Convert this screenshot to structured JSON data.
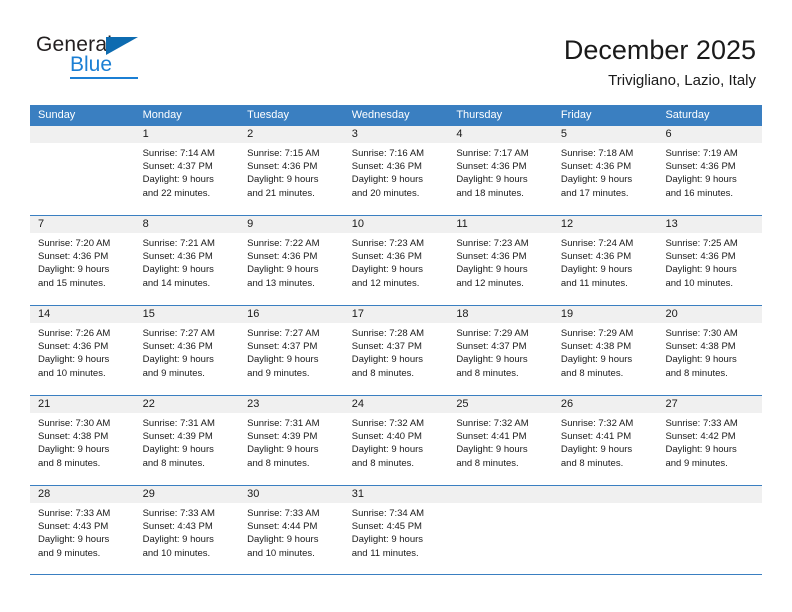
{
  "branding": {
    "name_part1": "General",
    "name_part2": "Blue",
    "logo_icon": "blue-triangle-icon"
  },
  "header": {
    "title": "December 2025",
    "subtitle": "Trivigliano, Lazio, Italy"
  },
  "calendar": {
    "weekdays": [
      "Sunday",
      "Monday",
      "Tuesday",
      "Wednesday",
      "Thursday",
      "Friday",
      "Saturday"
    ],
    "accent_color": "#3a7fc1",
    "daynum_background": "#f0f0f0",
    "weeks": [
      [
        {
          "day": "",
          "sunrise": "",
          "sunset": "",
          "daylight_line1": "",
          "daylight_line2": ""
        },
        {
          "day": "1",
          "sunrise": "Sunrise: 7:14 AM",
          "sunset": "Sunset: 4:37 PM",
          "daylight_line1": "Daylight: 9 hours",
          "daylight_line2": "and 22 minutes."
        },
        {
          "day": "2",
          "sunrise": "Sunrise: 7:15 AM",
          "sunset": "Sunset: 4:36 PM",
          "daylight_line1": "Daylight: 9 hours",
          "daylight_line2": "and 21 minutes."
        },
        {
          "day": "3",
          "sunrise": "Sunrise: 7:16 AM",
          "sunset": "Sunset: 4:36 PM",
          "daylight_line1": "Daylight: 9 hours",
          "daylight_line2": "and 20 minutes."
        },
        {
          "day": "4",
          "sunrise": "Sunrise: 7:17 AM",
          "sunset": "Sunset: 4:36 PM",
          "daylight_line1": "Daylight: 9 hours",
          "daylight_line2": "and 18 minutes."
        },
        {
          "day": "5",
          "sunrise": "Sunrise: 7:18 AM",
          "sunset": "Sunset: 4:36 PM",
          "daylight_line1": "Daylight: 9 hours",
          "daylight_line2": "and 17 minutes."
        },
        {
          "day": "6",
          "sunrise": "Sunrise: 7:19 AM",
          "sunset": "Sunset: 4:36 PM",
          "daylight_line1": "Daylight: 9 hours",
          "daylight_line2": "and 16 minutes."
        }
      ],
      [
        {
          "day": "7",
          "sunrise": "Sunrise: 7:20 AM",
          "sunset": "Sunset: 4:36 PM",
          "daylight_line1": "Daylight: 9 hours",
          "daylight_line2": "and 15 minutes."
        },
        {
          "day": "8",
          "sunrise": "Sunrise: 7:21 AM",
          "sunset": "Sunset: 4:36 PM",
          "daylight_line1": "Daylight: 9 hours",
          "daylight_line2": "and 14 minutes."
        },
        {
          "day": "9",
          "sunrise": "Sunrise: 7:22 AM",
          "sunset": "Sunset: 4:36 PM",
          "daylight_line1": "Daylight: 9 hours",
          "daylight_line2": "and 13 minutes."
        },
        {
          "day": "10",
          "sunrise": "Sunrise: 7:23 AM",
          "sunset": "Sunset: 4:36 PM",
          "daylight_line1": "Daylight: 9 hours",
          "daylight_line2": "and 12 minutes."
        },
        {
          "day": "11",
          "sunrise": "Sunrise: 7:23 AM",
          "sunset": "Sunset: 4:36 PM",
          "daylight_line1": "Daylight: 9 hours",
          "daylight_line2": "and 12 minutes."
        },
        {
          "day": "12",
          "sunrise": "Sunrise: 7:24 AM",
          "sunset": "Sunset: 4:36 PM",
          "daylight_line1": "Daylight: 9 hours",
          "daylight_line2": "and 11 minutes."
        },
        {
          "day": "13",
          "sunrise": "Sunrise: 7:25 AM",
          "sunset": "Sunset: 4:36 PM",
          "daylight_line1": "Daylight: 9 hours",
          "daylight_line2": "and 10 minutes."
        }
      ],
      [
        {
          "day": "14",
          "sunrise": "Sunrise: 7:26 AM",
          "sunset": "Sunset: 4:36 PM",
          "daylight_line1": "Daylight: 9 hours",
          "daylight_line2": "and 10 minutes."
        },
        {
          "day": "15",
          "sunrise": "Sunrise: 7:27 AM",
          "sunset": "Sunset: 4:36 PM",
          "daylight_line1": "Daylight: 9 hours",
          "daylight_line2": "and 9 minutes."
        },
        {
          "day": "16",
          "sunrise": "Sunrise: 7:27 AM",
          "sunset": "Sunset: 4:37 PM",
          "daylight_line1": "Daylight: 9 hours",
          "daylight_line2": "and 9 minutes."
        },
        {
          "day": "17",
          "sunrise": "Sunrise: 7:28 AM",
          "sunset": "Sunset: 4:37 PM",
          "daylight_line1": "Daylight: 9 hours",
          "daylight_line2": "and 8 minutes."
        },
        {
          "day": "18",
          "sunrise": "Sunrise: 7:29 AM",
          "sunset": "Sunset: 4:37 PM",
          "daylight_line1": "Daylight: 9 hours",
          "daylight_line2": "and 8 minutes."
        },
        {
          "day": "19",
          "sunrise": "Sunrise: 7:29 AM",
          "sunset": "Sunset: 4:38 PM",
          "daylight_line1": "Daylight: 9 hours",
          "daylight_line2": "and 8 minutes."
        },
        {
          "day": "20",
          "sunrise": "Sunrise: 7:30 AM",
          "sunset": "Sunset: 4:38 PM",
          "daylight_line1": "Daylight: 9 hours",
          "daylight_line2": "and 8 minutes."
        }
      ],
      [
        {
          "day": "21",
          "sunrise": "Sunrise: 7:30 AM",
          "sunset": "Sunset: 4:38 PM",
          "daylight_line1": "Daylight: 9 hours",
          "daylight_line2": "and 8 minutes."
        },
        {
          "day": "22",
          "sunrise": "Sunrise: 7:31 AM",
          "sunset": "Sunset: 4:39 PM",
          "daylight_line1": "Daylight: 9 hours",
          "daylight_line2": "and 8 minutes."
        },
        {
          "day": "23",
          "sunrise": "Sunrise: 7:31 AM",
          "sunset": "Sunset: 4:39 PM",
          "daylight_line1": "Daylight: 9 hours",
          "daylight_line2": "and 8 minutes."
        },
        {
          "day": "24",
          "sunrise": "Sunrise: 7:32 AM",
          "sunset": "Sunset: 4:40 PM",
          "daylight_line1": "Daylight: 9 hours",
          "daylight_line2": "and 8 minutes."
        },
        {
          "day": "25",
          "sunrise": "Sunrise: 7:32 AM",
          "sunset": "Sunset: 4:41 PM",
          "daylight_line1": "Daylight: 9 hours",
          "daylight_line2": "and 8 minutes."
        },
        {
          "day": "26",
          "sunrise": "Sunrise: 7:32 AM",
          "sunset": "Sunset: 4:41 PM",
          "daylight_line1": "Daylight: 9 hours",
          "daylight_line2": "and 8 minutes."
        },
        {
          "day": "27",
          "sunrise": "Sunrise: 7:33 AM",
          "sunset": "Sunset: 4:42 PM",
          "daylight_line1": "Daylight: 9 hours",
          "daylight_line2": "and 9 minutes."
        }
      ],
      [
        {
          "day": "28",
          "sunrise": "Sunrise: 7:33 AM",
          "sunset": "Sunset: 4:43 PM",
          "daylight_line1": "Daylight: 9 hours",
          "daylight_line2": "and 9 minutes."
        },
        {
          "day": "29",
          "sunrise": "Sunrise: 7:33 AM",
          "sunset": "Sunset: 4:43 PM",
          "daylight_line1": "Daylight: 9 hours",
          "daylight_line2": "and 10 minutes."
        },
        {
          "day": "30",
          "sunrise": "Sunrise: 7:33 AM",
          "sunset": "Sunset: 4:44 PM",
          "daylight_line1": "Daylight: 9 hours",
          "daylight_line2": "and 10 minutes."
        },
        {
          "day": "31",
          "sunrise": "Sunrise: 7:34 AM",
          "sunset": "Sunset: 4:45 PM",
          "daylight_line1": "Daylight: 9 hours",
          "daylight_line2": "and 11 minutes."
        },
        {
          "day": "",
          "sunrise": "",
          "sunset": "",
          "daylight_line1": "",
          "daylight_line2": ""
        },
        {
          "day": "",
          "sunrise": "",
          "sunset": "",
          "daylight_line1": "",
          "daylight_line2": ""
        },
        {
          "day": "",
          "sunrise": "",
          "sunset": "",
          "daylight_line1": "",
          "daylight_line2": ""
        }
      ]
    ]
  }
}
